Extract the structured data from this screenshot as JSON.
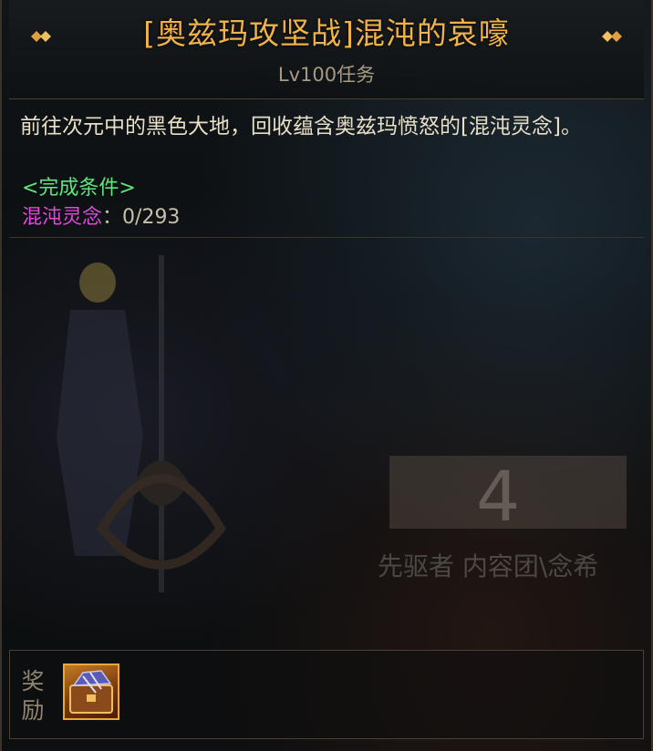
{
  "quest": {
    "title": "[奥兹玛攻坚战]混沌的哀嚎",
    "level": "Lv100任务",
    "description": "前往次元中的黑色大地，回收蕴含奥兹玛愤怒的[混沌灵念]。",
    "conditions_header": "<完成条件>",
    "condition": {
      "name": "混沌灵念",
      "separator": "：",
      "progress": "0/293",
      "current": 0,
      "target": 293
    }
  },
  "background": {
    "board_number": "4",
    "board_caption": "先驱者 内容团\\念希"
  },
  "reward": {
    "label_line1": "奖",
    "label_line2": "励",
    "item_icon": "armor-box-icon"
  },
  "colors": {
    "title": "#f0b24a",
    "condition_header": "#5fe57e",
    "condition_name": "#e04ad8",
    "reward_border": "#e8a83a"
  }
}
